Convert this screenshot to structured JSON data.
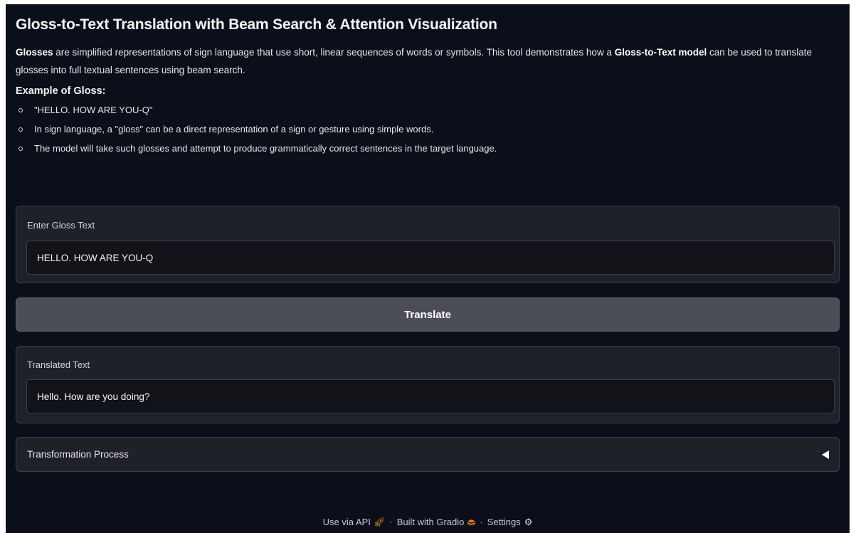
{
  "page": {
    "title": "Gloss-to-Text Translation with Beam Search & Attention Visualization"
  },
  "intro": {
    "bold_lead": "Glosses",
    "text1": " are simplified representations of sign language that use short, linear sequences of words or symbols. This tool demonstrates how a ",
    "bold_model": "Gloss-to-Text model",
    "text2": " can be used to translate glosses into full textual sentences using beam search."
  },
  "example": {
    "heading": "Example of Gloss:",
    "items": [
      "\"HELLO. HOW ARE YOU-Q\"",
      "In sign language, a \"gloss\" can be a direct representation of a sign or gesture using simple words.",
      "The model will take such glosses and attempt to produce grammatically correct sentences in the target language."
    ]
  },
  "input": {
    "label": "Enter Gloss Text",
    "value": "HELLO. HOW ARE YOU-Q"
  },
  "translate_button": {
    "label": "Translate"
  },
  "output": {
    "label": "Translated Text",
    "value": "Hello. How are you doing?"
  },
  "accordion": {
    "label": "Transformation Process",
    "expanded": false
  },
  "footer": {
    "api": "Use via API",
    "built": "Built with Gradio",
    "settings": "Settings",
    "separator": "·",
    "icons": [
      "rocket-icon",
      "gradio-logo-icon",
      "gear-icon"
    ]
  },
  "colors": {
    "background": "#0b0f19",
    "panel": "#1f2128",
    "button": "#4b4d57",
    "text": "#e5e7eb"
  }
}
